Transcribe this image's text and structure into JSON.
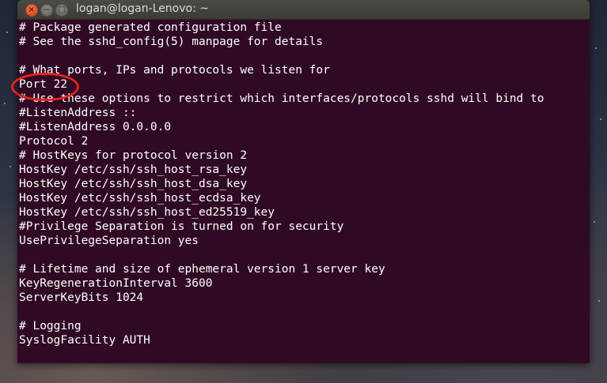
{
  "window": {
    "title": "logan@logan-Lenovo: ~",
    "close_glyph": "×",
    "minimize_glyph": "−",
    "maximize_glyph": "□"
  },
  "terminal": {
    "lines": [
      "# Package generated configuration file",
      "# See the sshd_config(5) manpage for details",
      "",
      "# What ports, IPs and protocols we listen for",
      "Port 22",
      "# Use these options to restrict which interfaces/protocols sshd will bind to",
      "#ListenAddress ::",
      "#ListenAddress 0.0.0.0",
      "Protocol 2",
      "# HostKeys for protocol version 2",
      "HostKey /etc/ssh/ssh_host_rsa_key",
      "HostKey /etc/ssh/ssh_host_dsa_key",
      "HostKey /etc/ssh/ssh_host_ecdsa_key",
      "HostKey /etc/ssh/ssh_host_ed25519_key",
      "#Privilege Separation is turned on for security",
      "UsePrivilegeSeparation yes",
      "",
      "# Lifetime and size of ephemeral version 1 server key",
      "KeyRegenerationInterval 3600",
      "ServerKeyBits 1024",
      "",
      "# Logging",
      "SyslogFacility AUTH"
    ]
  },
  "colors": {
    "terminal_bg": "#300a24",
    "terminal_fg": "#ffffff",
    "annotation_ring": "#e8201f",
    "close_button": "#e1501f"
  }
}
